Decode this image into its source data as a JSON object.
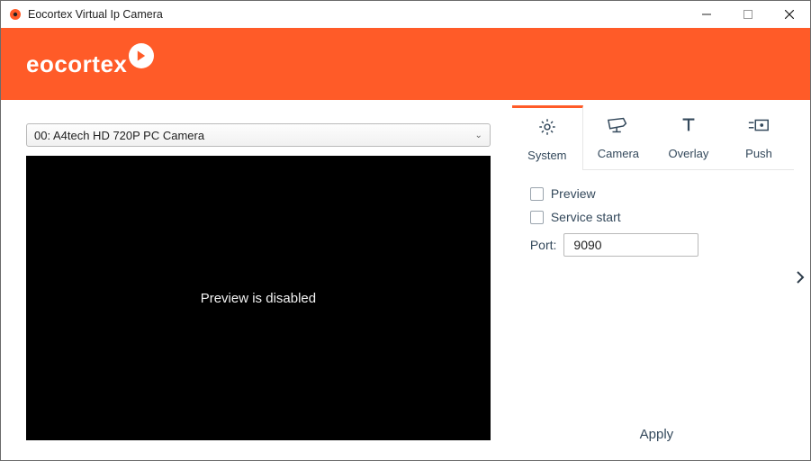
{
  "window": {
    "title": "Eocortex Virtual Ip Camera"
  },
  "brand": {
    "name": "eocortex"
  },
  "camera": {
    "selected": "00: A4tech HD 720P PC Camera"
  },
  "preview": {
    "message": "Preview is disabled"
  },
  "tabs": {
    "system": "System",
    "camera": "Camera",
    "overlay": "Overlay",
    "push": "Push"
  },
  "settings": {
    "preview_label": "Preview",
    "service_start_label": "Service start",
    "port_label": "Port:",
    "port_value": "9090"
  },
  "actions": {
    "apply": "Apply"
  }
}
